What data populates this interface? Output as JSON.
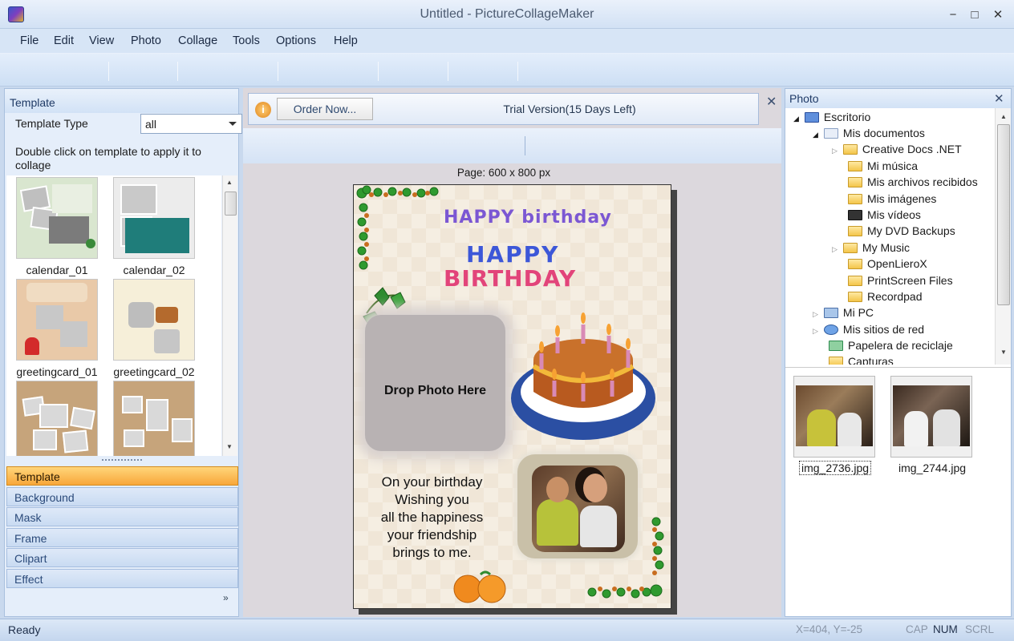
{
  "window": {
    "title": "Untitled - PictureCollageMaker",
    "minimize": "−",
    "maximize": "□",
    "close": "✕"
  },
  "menu": [
    "File",
    "Edit",
    "View",
    "Photo",
    "Collage",
    "Tools",
    "Options",
    "Help"
  ],
  "left_panel": {
    "header": "Template",
    "template_type_label": "Template Type",
    "template_type_value": "all",
    "hint": "Double click on template to apply it to collage",
    "templates": [
      "calendar_01",
      "calendar_02",
      "greetingcard_01",
      "greetingcard_02"
    ],
    "tabs": [
      "Template",
      "Background",
      "Mask",
      "Frame",
      "Clipart",
      "Effect"
    ],
    "active_tab": "Template",
    "more": "»"
  },
  "trial": {
    "info_icon": "i",
    "order_label": "Order Now...",
    "message": "Trial Version(15 Days Left)",
    "close": "✕"
  },
  "canvas": {
    "page_label": "Page: 600 x 800 px",
    "drop_text": "Drop Photo Here",
    "greeting_lines": [
      "On your birthday",
      "Wishing you",
      "all the happiness",
      "your friendship",
      "brings to me."
    ],
    "banner_top": "HAPPY birthday",
    "banner_big_1": "HAPPY",
    "banner_big_2": "BIRTHDAY"
  },
  "photo_panel": {
    "header": "Photo",
    "close": "✕",
    "tree": [
      {
        "label": "Escritorio",
        "icon": "desktop-icon"
      },
      {
        "label": "Mis documentos",
        "icon": "documents-icon"
      },
      {
        "label": "Creative Docs .NET",
        "icon": "folder-icon"
      },
      {
        "label": "Mi música",
        "icon": "music-folder-icon"
      },
      {
        "label": "Mis archivos recibidos",
        "icon": "folder-icon"
      },
      {
        "label": "Mis imágenes",
        "icon": "pictures-folder-icon"
      },
      {
        "label": "Mis vídeos",
        "icon": "video-folder-icon"
      },
      {
        "label": "My DVD Backups",
        "icon": "folder-icon"
      },
      {
        "label": "My Music",
        "icon": "folder-icon"
      },
      {
        "label": "OpenLieroX",
        "icon": "folder-icon"
      },
      {
        "label": "PrintScreen Files",
        "icon": "folder-icon"
      },
      {
        "label": "Recordpad",
        "icon": "folder-icon"
      },
      {
        "label": "Mi PC",
        "icon": "computer-icon"
      },
      {
        "label": "Mis sitios de red",
        "icon": "network-icon"
      },
      {
        "label": "Papelera de reciclaje",
        "icon": "recycle-bin-icon"
      },
      {
        "label": "Capturas",
        "icon": "folder-icon"
      }
    ],
    "photos": [
      "img_2736.jpg",
      "img_2744.jpg"
    ]
  },
  "status": {
    "text": "Ready",
    "coords": "X=404, Y=-25",
    "cap": "CAP",
    "num": "NUM",
    "scrl": "SCRL"
  }
}
